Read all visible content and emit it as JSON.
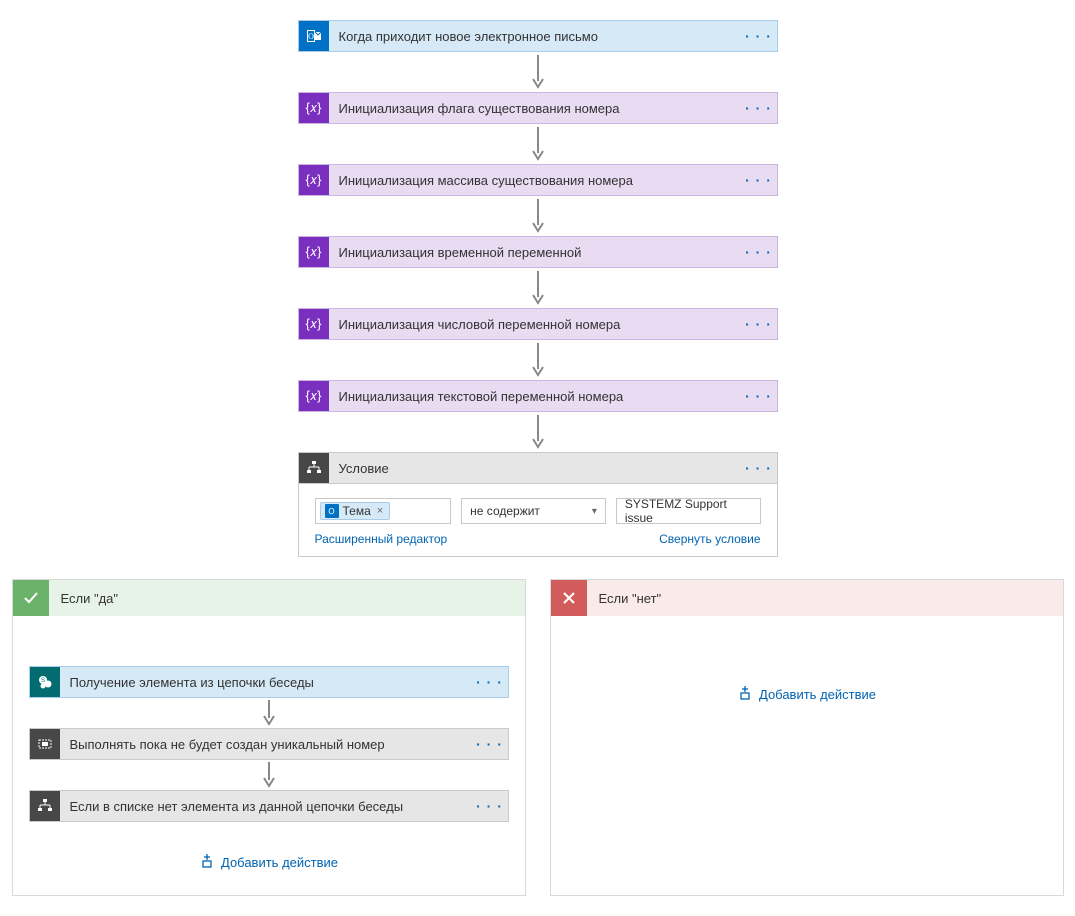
{
  "ellipsis": "· · ·",
  "trigger": {
    "title": "Когда приходит новое электронное письмо",
    "icon": "outlook-icon"
  },
  "vars": [
    {
      "title": "Инициализация флага существования номера"
    },
    {
      "title": "Инициализация массива существования номера"
    },
    {
      "title": "Инициализация временной переменной"
    },
    {
      "title": "Инициализация числовой переменной номера"
    },
    {
      "title": "Инициализация текстовой переменной номера"
    }
  ],
  "condition": {
    "title": "Условие",
    "token_label": "Тема",
    "token_remove": "×",
    "operator": "не содержит",
    "value": "SYSTEMZ Support issue",
    "link_left": "Расширенный редактор",
    "link_right": "Свернуть условие"
  },
  "branch_yes": {
    "title": "Если \"да\"",
    "steps": [
      {
        "kind": "sharepoint",
        "title": "Получение элемента из цепочки беседы"
      },
      {
        "kind": "loop",
        "title": "Выполнять пока не будет создан уникальный номер"
      },
      {
        "kind": "cond2",
        "title": "Если в списке нет элемента из данной цепочки беседы"
      }
    ],
    "add_action": "Добавить действие"
  },
  "branch_no": {
    "title": "Если \"нет\"",
    "add_action": "Добавить действие"
  }
}
